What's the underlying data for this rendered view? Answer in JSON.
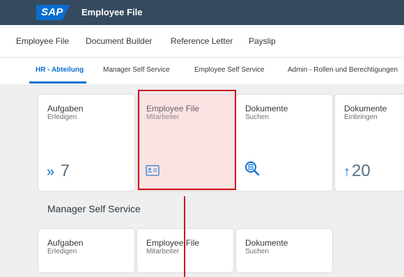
{
  "shell": {
    "logo_text": "SAP",
    "title": "Employee File"
  },
  "menu": [
    {
      "label": "Employee File"
    },
    {
      "label": "Document Builder"
    },
    {
      "label": "Reference Letter"
    },
    {
      "label": "Payslip"
    }
  ],
  "tabs": [
    {
      "label": "HR - Abteilung",
      "active": true
    },
    {
      "label": "Manager Self Service"
    },
    {
      "label": "Employee Self Service"
    },
    {
      "label": "Admin - Rollen und Berechtigungen"
    }
  ],
  "group1": {
    "tiles": [
      {
        "title": "Aufgaben",
        "subtitle": "Erledigen",
        "icon": "chevrons-right-icon",
        "icon_glyph": "»",
        "number": "7"
      },
      {
        "title": "Employee File",
        "subtitle": "Mitarbeiter",
        "icon": "id-card-icon"
      },
      {
        "title": "Dokumente",
        "subtitle": "Suchen",
        "icon": "document-search-icon"
      },
      {
        "title": "Dokumente",
        "subtitle": "Einbringen",
        "icon": "upload-icon",
        "icon_glyph": "↑",
        "number": "20"
      }
    ]
  },
  "group2": {
    "title": "Manager Self Service",
    "tiles": [
      {
        "title": "Aufgaben",
        "subtitle": "Erledigen"
      },
      {
        "title": "Employee File",
        "subtitle": "Mitarbeiter"
      },
      {
        "title": "Dokumente",
        "subtitle": "Suchen"
      }
    ]
  },
  "colors": {
    "shell": "#354a5f",
    "accent": "#0a6ed1",
    "annotation": "#d0021b",
    "background": "#edeff0"
  }
}
